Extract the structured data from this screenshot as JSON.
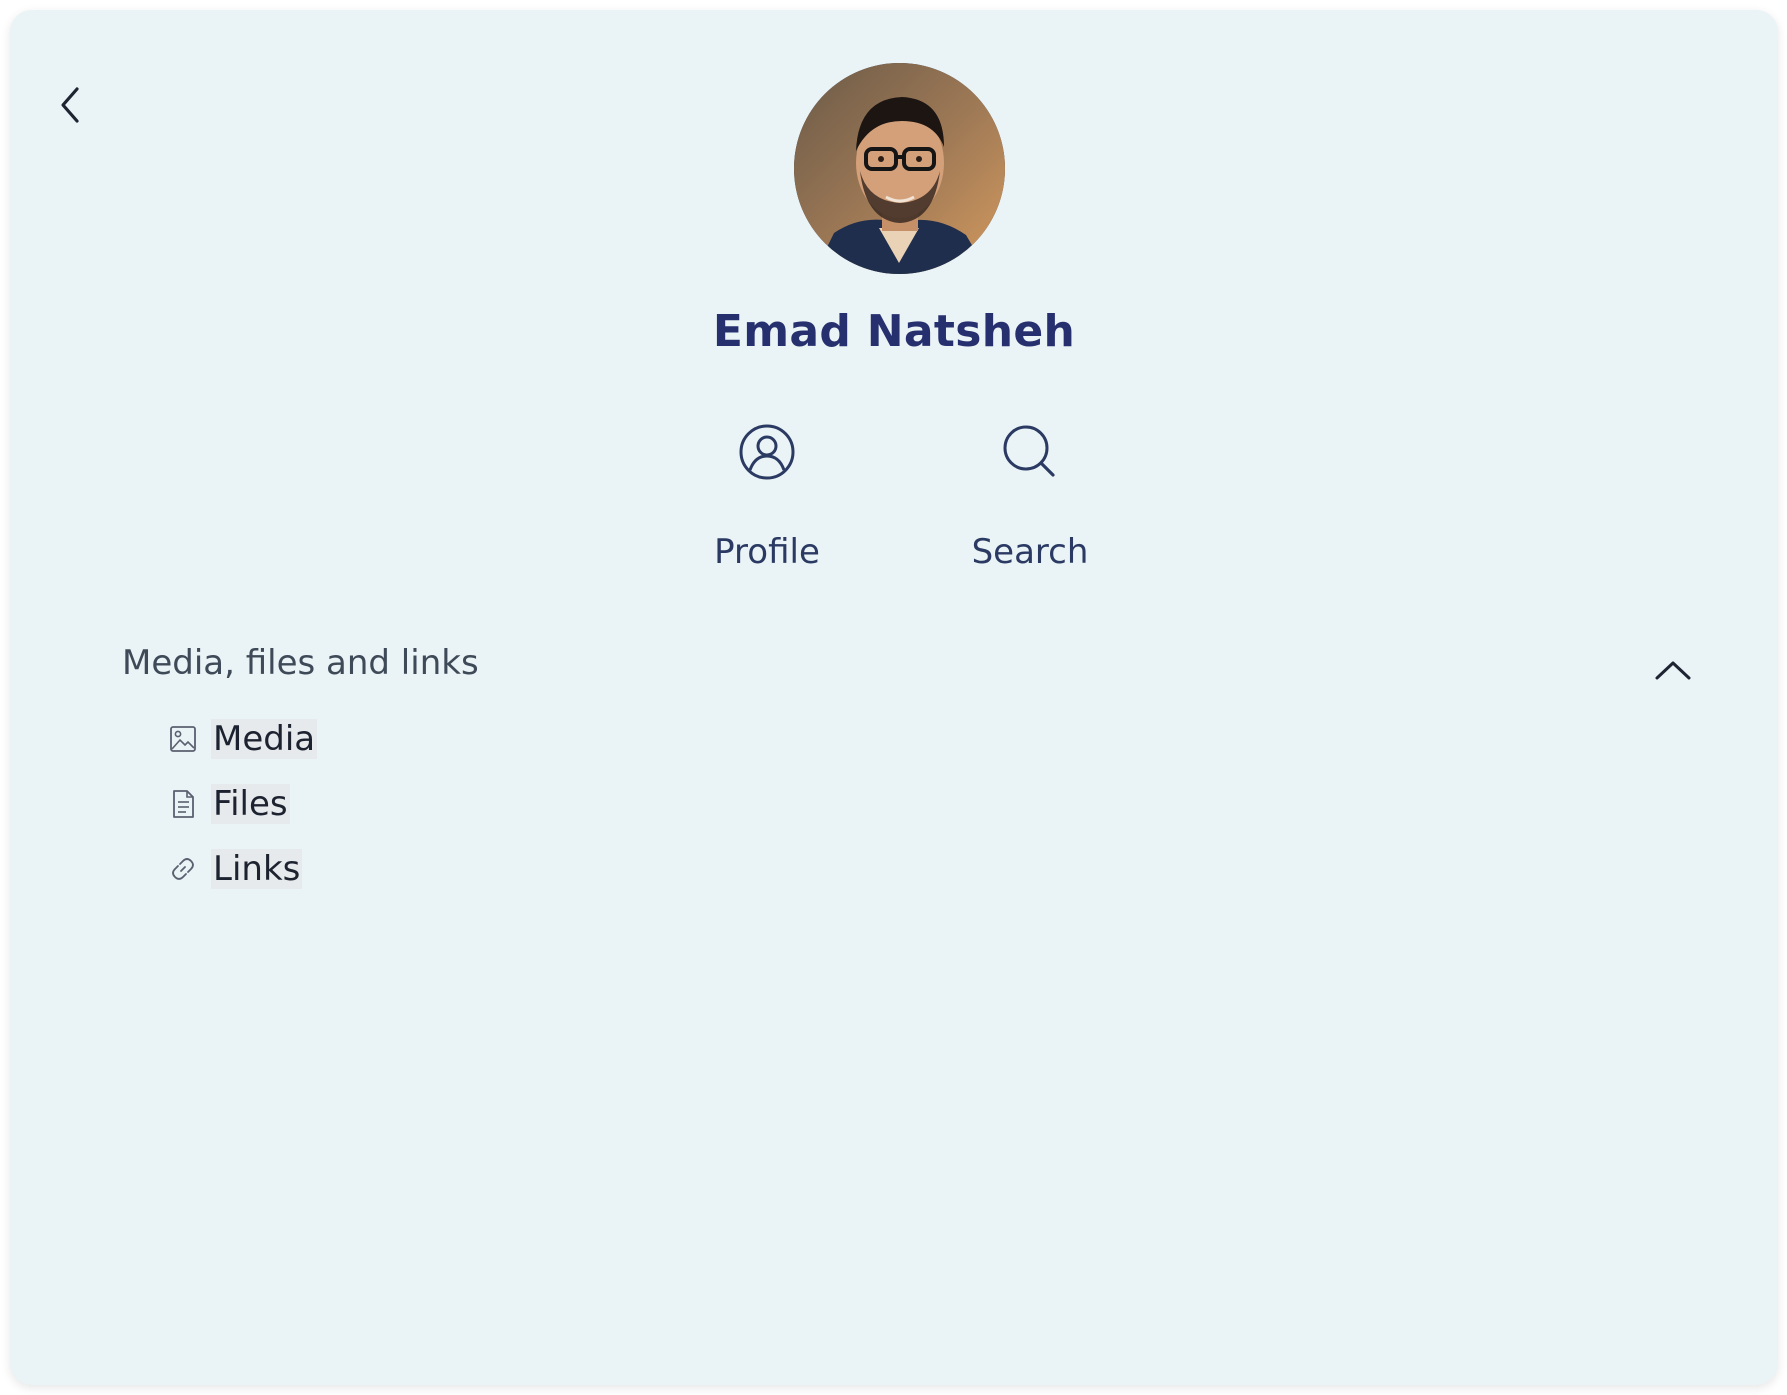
{
  "contact": {
    "name": "Emad Natsheh",
    "avatar_alt": "Emad Natsheh profile photo"
  },
  "actions": [
    {
      "label": "Profile",
      "icon": "user-circle-icon"
    },
    {
      "label": "Search",
      "icon": "search-icon"
    }
  ],
  "section": {
    "title": "Media, files and links",
    "state": "expanded",
    "items": [
      {
        "label": "Media",
        "icon": "image-icon"
      },
      {
        "label": "Files",
        "icon": "file-icon"
      },
      {
        "label": "Links",
        "icon": "link-icon"
      }
    ]
  },
  "colors": {
    "panel_background": "#eaf3f5",
    "name_color": "#27306f",
    "accent": "#2b3a63"
  }
}
